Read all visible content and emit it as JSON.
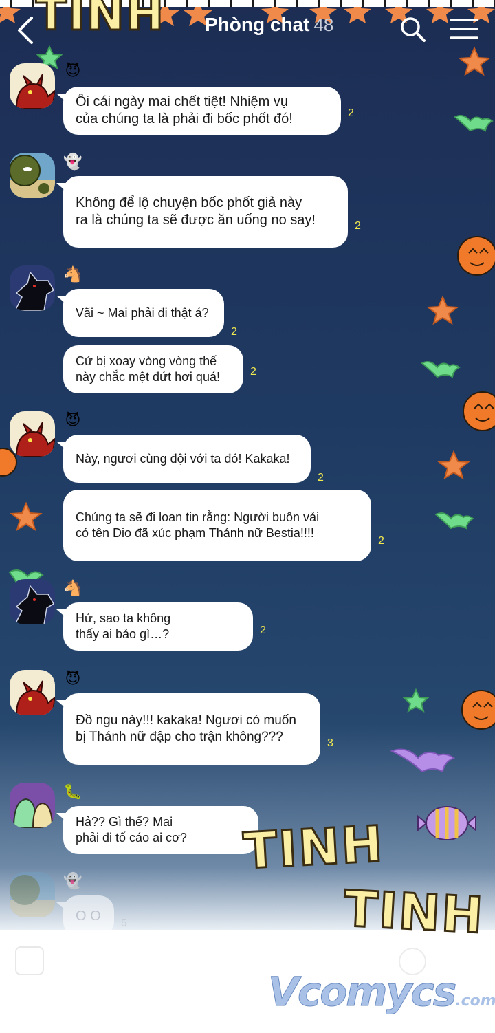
{
  "header": {
    "title": "Phòng chat",
    "member_count": "48",
    "back_icon": "chevron-left-icon",
    "search_icon": "search-icon",
    "menu_icon": "hamburger-menu-icon"
  },
  "messages": [
    {
      "sender_emoji": "😈",
      "text_lines": [
        "Ôi cái ngày mai chết tiệt! Nhiệm vụ",
        "của chúng ta là phải đi bốc phốt đó!"
      ],
      "read_count": "2"
    },
    {
      "sender_emoji": "👻",
      "text_lines": [
        "Không để lộ chuyện bốc phốt giả này",
        "ra là chúng ta sẽ được ăn uống no say!"
      ],
      "read_count": "2"
    },
    {
      "sender_emoji": "🐴",
      "text_lines": [
        "Vãi ~ Mai phải đi thật á?"
      ],
      "read_count": "2"
    },
    {
      "sender_emoji": "",
      "text_lines": [
        "Cứ bị xoay vòng vòng thế",
        "này chắc mệt đứt hơi quá!"
      ],
      "read_count": "2"
    },
    {
      "sender_emoji": "😈",
      "text_lines": [
        "Này, ngươi cùng đội với ta đó! Kakaka!"
      ],
      "read_count": "2"
    },
    {
      "sender_emoji": "",
      "text_lines": [
        "Chúng ta sẽ đi loan tin rằng: Người buôn vải",
        "có tên Dio đã xúc phạm Thánh nữ Bestia!!!!"
      ],
      "read_count": "2"
    },
    {
      "sender_emoji": "🐴",
      "text_lines": [
        "Hử, sao ta không",
        "thấy ai bảo gì…?"
      ],
      "read_count": "2"
    },
    {
      "sender_emoji": "😈",
      "text_lines": [
        "Đồ ngu này!!! kakaka! Ngươi có muốn",
        "bị Thánh nữ đập cho trận không???"
      ],
      "read_count": "3"
    },
    {
      "sender_emoji": "🐛",
      "text_lines": [
        "Hả?? Gì thế? Mai",
        "phải đi tố cáo ai cơ?"
      ],
      "read_count": ""
    },
    {
      "sender_emoji": "👻",
      "text_lines": [
        "O O"
      ],
      "read_count": "5"
    }
  ],
  "overlay_text": {
    "tinh_top": "TINH",
    "tinh_bottom_1": "TINH",
    "tinh_bottom_2": "TINH"
  },
  "watermark": {
    "brand": "Vcomycs",
    "suffix": ".com"
  },
  "inputbar": {
    "plus_icon": "plus-icon",
    "emoji_icon": "emoji-icon"
  },
  "colors": {
    "bubble": "#ffffff",
    "read_count": "#f2e94e",
    "background_top": "#1d2d54"
  }
}
